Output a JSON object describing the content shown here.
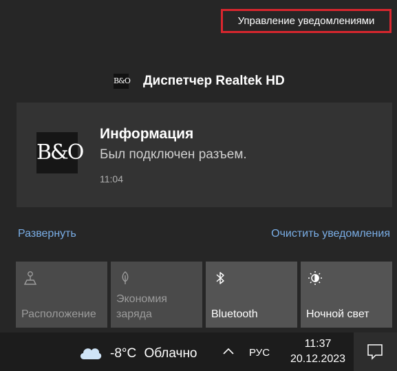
{
  "action_center": {
    "manage_link": "Управление уведомлениями",
    "app": {
      "name": "Диспетчер Realtek HD",
      "logo_text": "B&O"
    },
    "notification": {
      "title": "Информация",
      "body": "Был подключен разъем.",
      "time": "11:04"
    },
    "expand_label": "Развернуть",
    "clear_label": "Очистить уведомления",
    "tiles": [
      {
        "label": "Расположение",
        "icon": "location-icon",
        "active": false
      },
      {
        "label": "Экономия заряда",
        "icon": "battery-saver-icon",
        "active": false
      },
      {
        "label": "Bluetooth",
        "icon": "bluetooth-icon",
        "active": true
      },
      {
        "label": "Ночной свет",
        "icon": "night-light-icon",
        "active": true
      }
    ]
  },
  "taskbar": {
    "weather": {
      "temp": "-8°C",
      "condition": "Облачно",
      "icon": "cloud-icon"
    },
    "language": "РУС",
    "time": "11:37",
    "date": "20.12.2023"
  },
  "colors": {
    "accent_link": "#7aaee6",
    "highlight_border": "#d9262e"
  }
}
